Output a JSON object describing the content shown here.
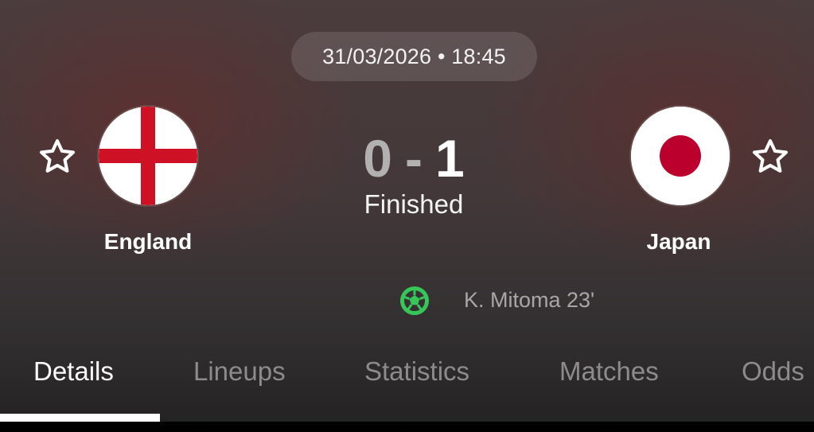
{
  "match": {
    "datetime": "31/03/2026 • 18:45",
    "home_score": "0",
    "separator": "-",
    "away_score": "1",
    "status": "Finished"
  },
  "home_team": {
    "name": "England",
    "flag": "england-flag-icon",
    "favorite_icon": "star-outline-icon"
  },
  "away_team": {
    "name": "Japan",
    "flag": "japan-flag-icon",
    "favorite_icon": "star-outline-icon"
  },
  "goals": [
    {
      "icon": "football-icon",
      "text": "K. Mitoma 23'"
    }
  ],
  "tabs": [
    {
      "label": "Details",
      "active": true
    },
    {
      "label": "Lineups",
      "active": false
    },
    {
      "label": "Statistics",
      "active": false
    },
    {
      "label": "Matches",
      "active": false
    },
    {
      "label": "Odds",
      "active": false
    }
  ],
  "colors": {
    "goal_icon": "#37c759",
    "england_cross": "#ce1124",
    "japan_disc": "#bc002d",
    "active_tab": "#ffffff",
    "inactive_tab": "#8e8b8c"
  }
}
